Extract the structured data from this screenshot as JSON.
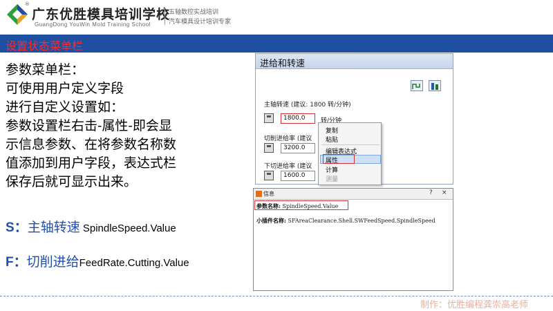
{
  "header": {
    "school_name": "广东优胜模具培训学校",
    "school_en": "GuangDong YouWin Mold Training School",
    "slogan_1": "五轴数控实战培训",
    "slogan_2": "汽车模具设计培训专家",
    "registered_mark": "®",
    "brand_colors": [
      "#2e9e3e",
      "#1f4fa0",
      "#f0a020"
    ]
  },
  "title": "设置状态菜单栏",
  "body": {
    "lines": [
      "参数菜单栏：",
      "可使用用户定义字段",
      "进行自定义设置如：",
      "参数设置栏右击-属性-即会显",
      "示信息参数、在将参数名称数",
      "值添加到用户字段，表达式栏",
      "保存后就可显示出来。"
    ],
    "params": [
      {
        "key": "S：",
        "cn": "主轴转速",
        "value": " SpindleSpeed.Value"
      },
      {
        "key": "F：",
        "cn": "切削进给",
        "value": "FeedRate.Cutting.Value"
      }
    ]
  },
  "feed_dialog": {
    "title": "进给和转速",
    "spindle_label": "主轴转速 (建议: 1800 转/分钟)",
    "spindle_value": "1800.0",
    "spindle_unit": "转/分钟",
    "cut_label": "切削进给率 (建议",
    "cut_value": "3200.0",
    "plunge_label": "下切进给率 (建议",
    "plunge_value": "1600.0"
  },
  "context_menu": {
    "items": [
      "复制",
      "粘贴",
      "编辑表达式",
      "属性",
      "计算",
      "测量"
    ],
    "selected": "属性"
  },
  "info_dialog": {
    "title": "信息",
    "help": "?",
    "close": "×",
    "param_name_label": "参数名称:",
    "param_name_value": " SpindleSpeed.Value",
    "plugin_label": "小插件名称:",
    "plugin_value": " SFAreaClearance.Shell.SWFeedSpeed.SpindleSpeed"
  },
  "footer": "制作：优胜编程龚崇高老师"
}
